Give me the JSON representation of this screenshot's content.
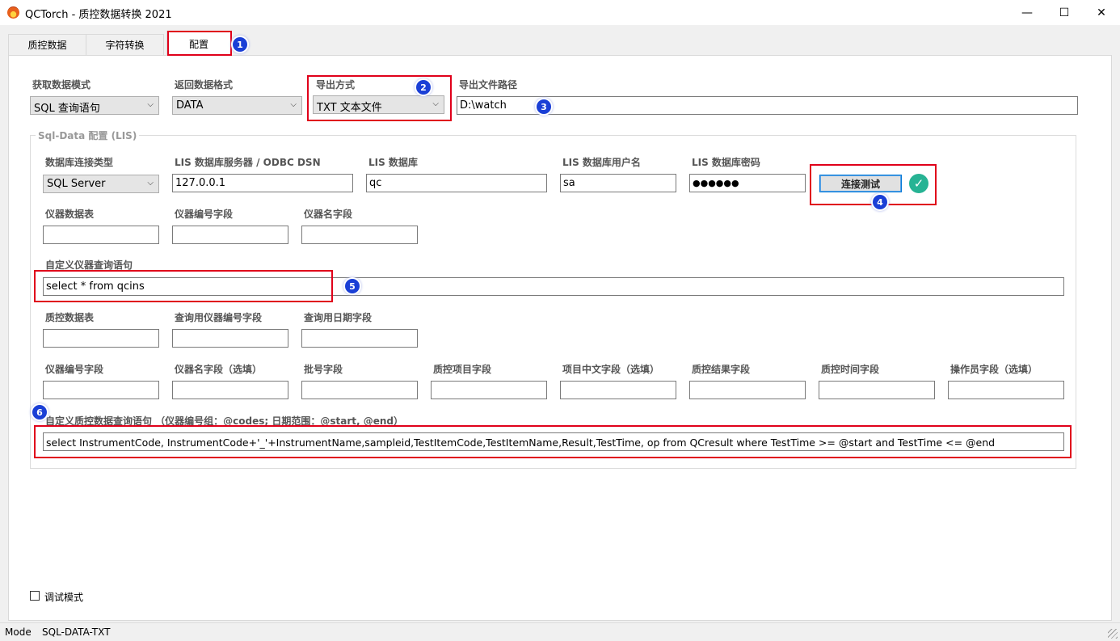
{
  "window": {
    "title": "QCTorch - 质控数据转换 2021",
    "minimize_glyph": "—",
    "maximize_glyph": "☐",
    "close_glyph": "✕"
  },
  "tabs": [
    {
      "label": "质控数据"
    },
    {
      "label": "字符转换"
    },
    {
      "label": "配置"
    }
  ],
  "top_row": {
    "fetch_mode_label": "获取数据模式",
    "fetch_mode_value": "SQL 查询语句",
    "return_format_label": "返回数据格式",
    "return_format_value": "DATA",
    "export_method_label": "导出方式",
    "export_method_value": "TXT 文本文件",
    "export_path_label": "导出文件路径",
    "export_path_value": "D:\\watch"
  },
  "group": {
    "title": "Sql-Data 配置 (LIS)",
    "db_type_label": "数据库连接类型",
    "db_type_value": "SQL Server",
    "server_label": "LIS 数据库服务器 / ODBC DSN",
    "server_value": "127.0.0.1",
    "database_label": "LIS 数据库",
    "database_value": "qc",
    "user_label": "LIS 数据库用户名",
    "user_value": "sa",
    "password_label": "LIS 数据库密码",
    "password_value": "●●●●●●",
    "test_button": "连接测试",
    "instrument_table_label": "仪器数据表",
    "instrument_code_field_label": "仪器编号字段",
    "instrument_name_field_label": "仪器名字段",
    "custom_instrument_query_label": "自定义仪器查询语句",
    "custom_instrument_query_value": "select * from qcins",
    "qc_table_label": "质控数据表",
    "qc_query_code_field_label": "查询用仪器编号字段",
    "qc_query_date_field_label": "查询用日期字段",
    "fields": [
      {
        "label": "仪器编号字段"
      },
      {
        "label": "仪器名字段（选填）"
      },
      {
        "label": "批号字段"
      },
      {
        "label": "质控项目字段"
      },
      {
        "label": "项目中文字段（选填）"
      },
      {
        "label": "质控结果字段"
      },
      {
        "label": "质控时间字段"
      },
      {
        "label": "操作员字段（选填）"
      }
    ],
    "custom_qc_query_label": "自定义质控数据查询语句  （仪器编号组：@codes; 日期范围：@start, @end）",
    "custom_qc_query_value": "select InstrumentCode, InstrumentCode+'_'+InstrumentName,sampleid,TestItemCode,TestItemName,Result,TestTime, op  from  QCresult where TestTime >= @start  and TestTime <=  @end"
  },
  "debug": {
    "label": "调试模式"
  },
  "badges": [
    "1",
    "2",
    "3",
    "4",
    "5",
    "6"
  ],
  "status": {
    "mode_label": "Mode",
    "mode_value": "SQL-DATA-TXT"
  },
  "icons": {
    "app": "flame-app-icon",
    "ok": "check-circle-icon",
    "dropdown": "chevron-down-icon"
  },
  "colors": {
    "highlight": "#e0001a",
    "badge": "#1a3fd6",
    "success": "#27b394",
    "focus": "#0078d7"
  }
}
